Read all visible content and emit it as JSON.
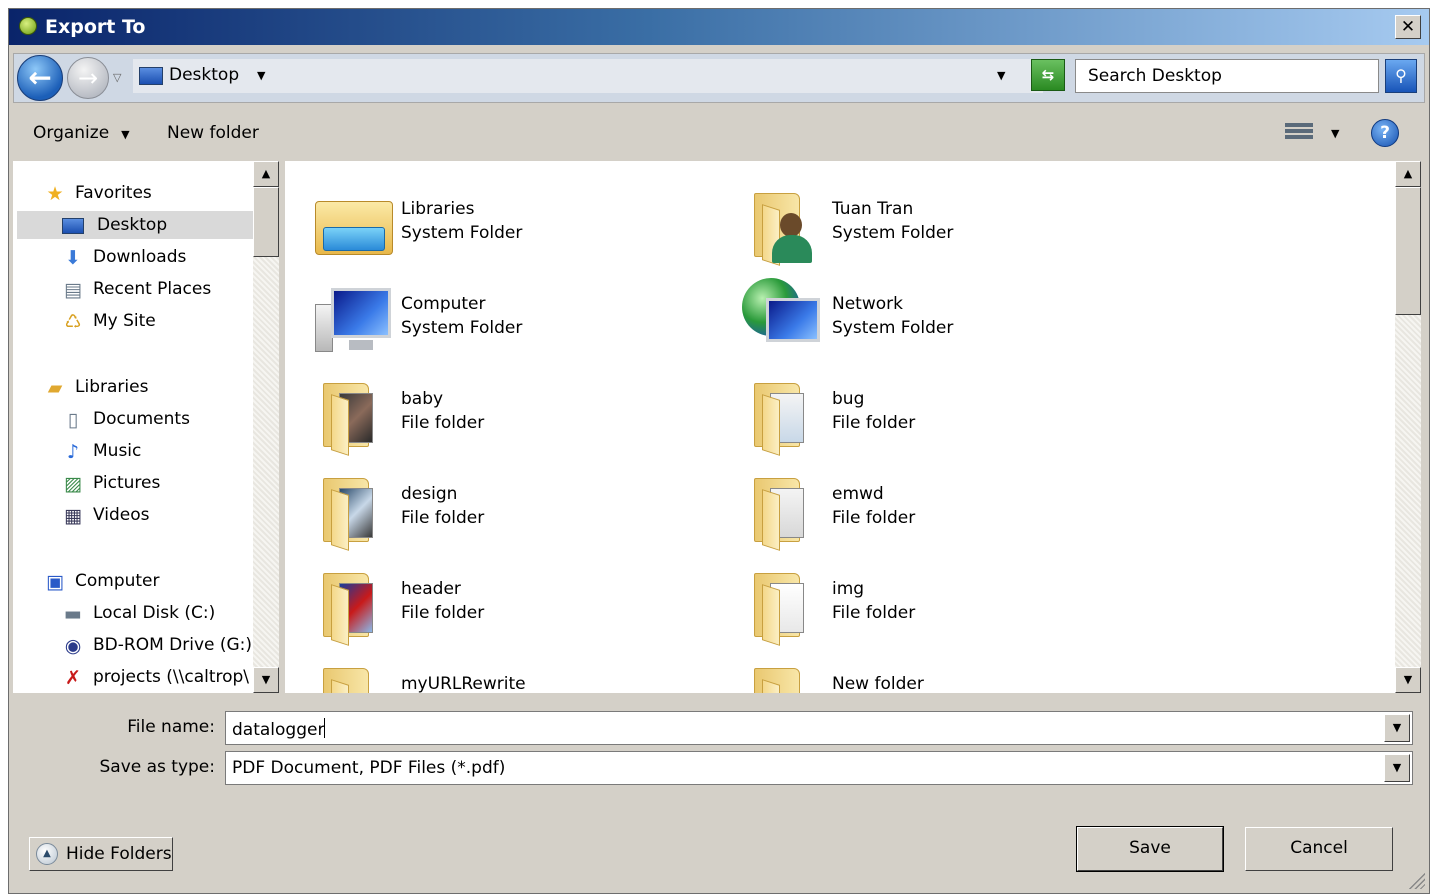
{
  "window": {
    "title": "Export To",
    "close_label": "✕"
  },
  "address": {
    "location": "Desktop",
    "search_placeholder": "Search Desktop"
  },
  "toolbar": {
    "organize_label": "Organize",
    "new_folder_label": "New folder"
  },
  "nav": {
    "favorites": {
      "label": "Favorites",
      "items": [
        "Desktop",
        "Downloads",
        "Recent Places",
        "My Site"
      ]
    },
    "libraries": {
      "label": "Libraries",
      "items": [
        "Documents",
        "Music",
        "Pictures",
        "Videos"
      ]
    },
    "computer": {
      "label": "Computer",
      "items": [
        "Local Disk (C:)",
        "BD-ROM Drive (G:)",
        "projects (\\\\caltrop\\"
      ]
    },
    "selected": "Desktop"
  },
  "items": [
    {
      "name": "Libraries",
      "type": "System Folder",
      "icon": "libraries-icon"
    },
    {
      "name": "Tuan Tran",
      "type": "System Folder",
      "icon": "user-folder-icon"
    },
    {
      "name": "Computer",
      "type": "System Folder",
      "icon": "computer-icon"
    },
    {
      "name": "Network",
      "type": "System Folder",
      "icon": "network-icon"
    },
    {
      "name": "baby",
      "type": "File folder",
      "icon": "folder-icon"
    },
    {
      "name": "bug",
      "type": "File folder",
      "icon": "folder-icon"
    },
    {
      "name": "design",
      "type": "File folder",
      "icon": "folder-icon"
    },
    {
      "name": "emwd",
      "type": "File folder",
      "icon": "folder-icon"
    },
    {
      "name": "header",
      "type": "File folder",
      "icon": "folder-icon"
    },
    {
      "name": "img",
      "type": "File folder",
      "icon": "folder-icon"
    },
    {
      "name": "myURLRewrite",
      "type": "",
      "icon": "folder-icon"
    },
    {
      "name": "New folder",
      "type": "",
      "icon": "folder-icon"
    }
  ],
  "form": {
    "file_name_label": "File name:",
    "file_name_value": "datalogger",
    "save_type_label": "Save as type:",
    "save_type_value": "PDF Document, PDF Files (*.pdf)"
  },
  "buttons": {
    "hide_folders": "Hide Folders",
    "save": "Save",
    "cancel": "Cancel"
  }
}
